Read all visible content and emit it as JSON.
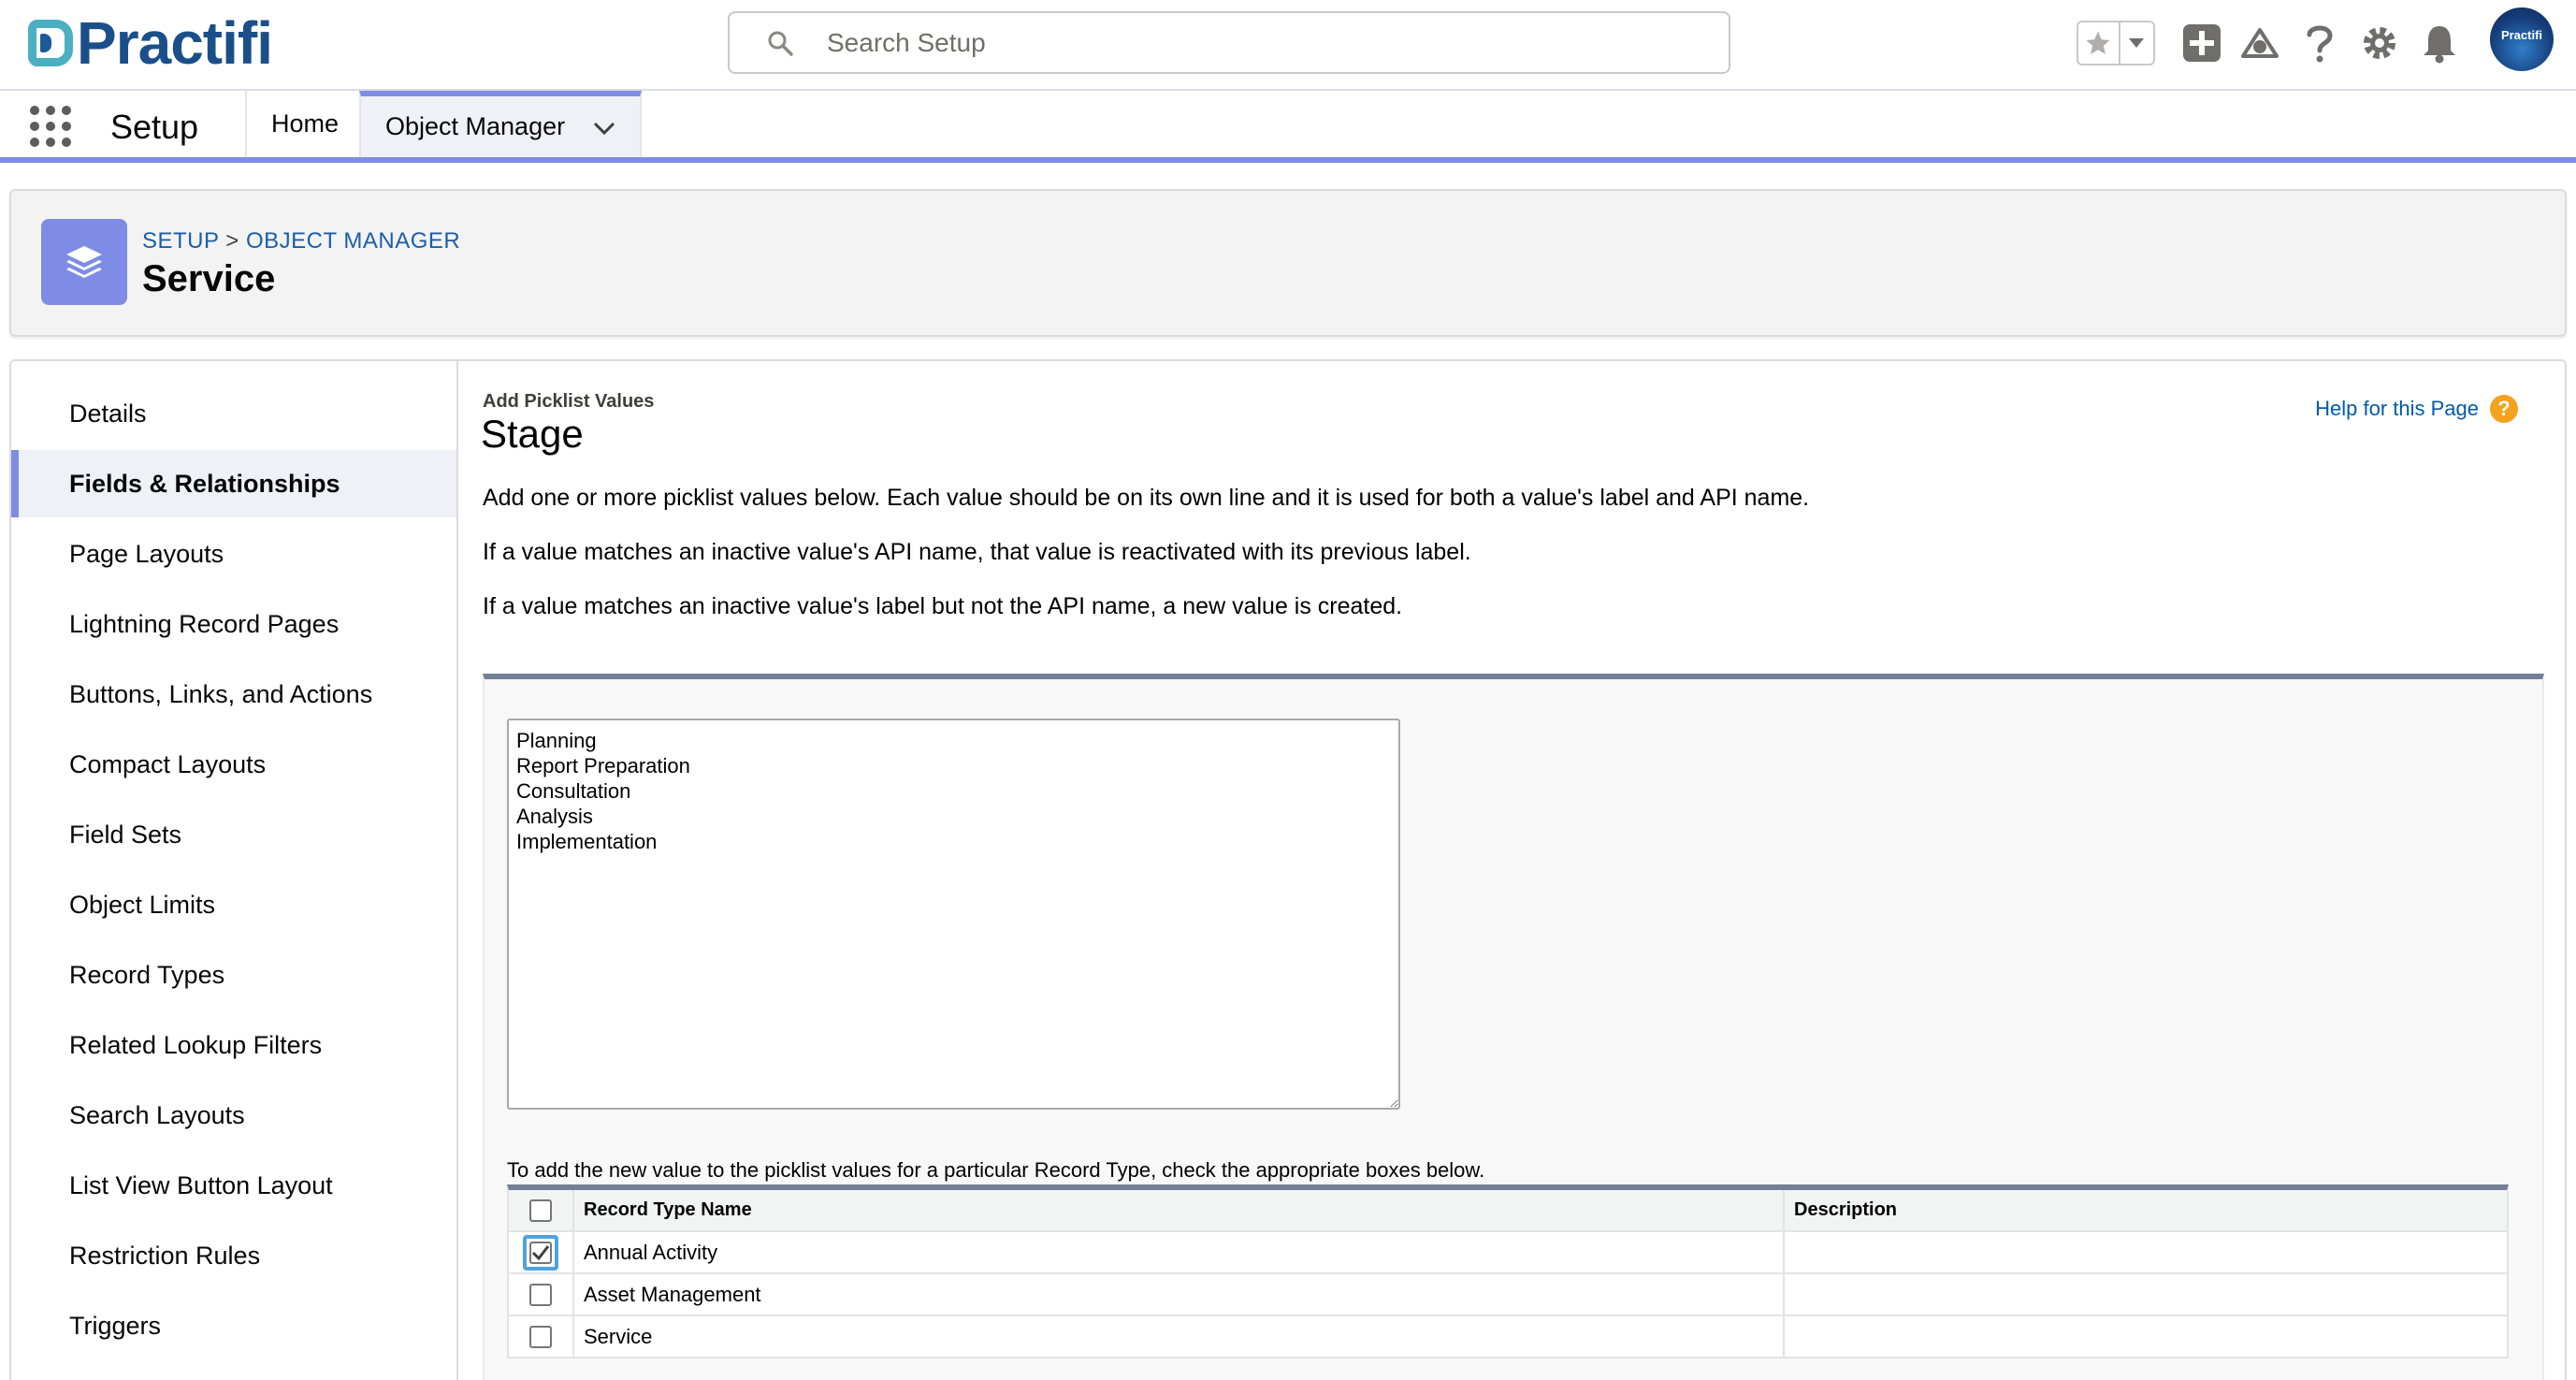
{
  "header": {
    "logo_text": "Practifi",
    "search_placeholder": "Search Setup",
    "avatar_text": "Practifi",
    "colors": {
      "accent": "#7f8ce5",
      "brand_blue": "#1b4f8a",
      "brand_teal": "#4ab0c1"
    }
  },
  "nav": {
    "app_name": "Setup",
    "tabs": [
      {
        "label": "Home"
      },
      {
        "label": "Object Manager"
      }
    ]
  },
  "page_header": {
    "breadcrumb_setup": "SETUP",
    "breadcrumb_sep": ">",
    "breadcrumb_om": "OBJECT MANAGER",
    "title": "Service",
    "icon": "layers-icon"
  },
  "sidebar": {
    "items": [
      {
        "label": "Details"
      },
      {
        "label": "Fields & Relationships"
      },
      {
        "label": "Page Layouts"
      },
      {
        "label": "Lightning Record Pages"
      },
      {
        "label": "Buttons, Links, and Actions"
      },
      {
        "label": "Compact Layouts"
      },
      {
        "label": "Field Sets"
      },
      {
        "label": "Object Limits"
      },
      {
        "label": "Record Types"
      },
      {
        "label": "Related Lookup Filters"
      },
      {
        "label": "Search Layouts"
      },
      {
        "label": "List View Button Layout"
      },
      {
        "label": "Restriction Rules"
      },
      {
        "label": "Triggers"
      }
    ],
    "active": "Fields & Relationships"
  },
  "content": {
    "section_label": "Add Picklist Values",
    "title": "Stage",
    "help_link": "Help for this Page",
    "help_badge": "?",
    "instructions": [
      "Add one or more picklist values below. Each value should be on its own line and it is used for both a value's label and API name.",
      "If a value matches an inactive value's API name, that value is reactivated with its previous label.",
      "If a value matches an inactive value's label but not the API name, a new value is created."
    ],
    "picklist_values": "Planning\nReport Preparation\nConsultation\nAnalysis\nImplementation",
    "record_type_caption": "To add the new value to the picklist values for a particular Record Type, check the appropriate boxes below.",
    "table": {
      "col_name": "Record Type Name",
      "col_desc": "Description",
      "rows": [
        {
          "name": "Annual Activity",
          "description": "",
          "checked": true
        },
        {
          "name": "Asset Management",
          "description": "",
          "checked": false
        },
        {
          "name": "Service",
          "description": "",
          "checked": false
        }
      ]
    }
  }
}
